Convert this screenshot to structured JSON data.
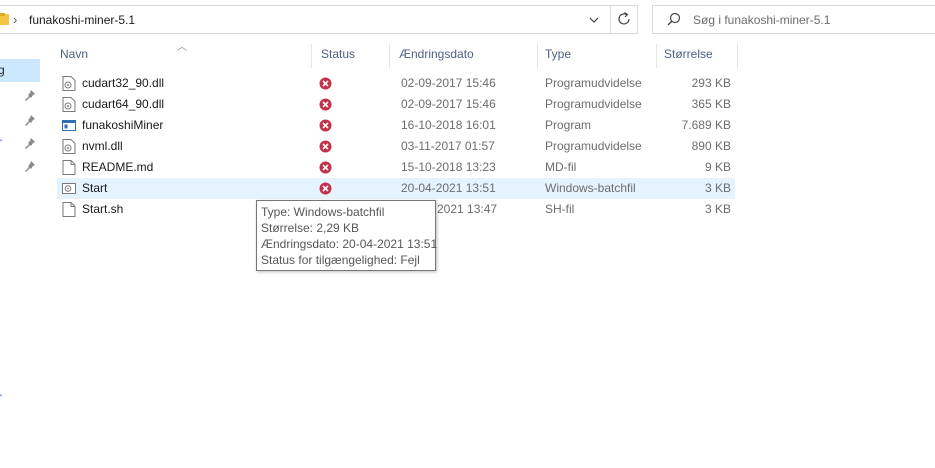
{
  "address": {
    "path": "funakoshi-miner-5.1",
    "separator": "›"
  },
  "search": {
    "placeholder": "Søg i funakoshi-miner-5.1"
  },
  "nav": {
    "selected_fragment": "g",
    "edge_fragments": [
      "r",
      "r"
    ]
  },
  "columns": {
    "name": "Navn",
    "status": "Status",
    "date": "Ændringsdato",
    "type": "Type",
    "size": "Størrelse"
  },
  "files": [
    {
      "name": "cudart32_90.dll",
      "date": "02-09-2017 15:46",
      "type": "Programudvidelse",
      "size": "293 KB",
      "icon": "dll-file-icon"
    },
    {
      "name": "cudart64_90.dll",
      "date": "02-09-2017 15:46",
      "type": "Programudvidelse",
      "size": "365 KB",
      "icon": "dll-file-icon"
    },
    {
      "name": "funakoshiMiner",
      "date": "16-10-2018 16:01",
      "type": "Program",
      "size": "7.689 KB",
      "icon": "exe-file-icon"
    },
    {
      "name": "nvml.dll",
      "date": "03-11-2017 01:57",
      "type": "Programudvidelse",
      "size": "890 KB",
      "icon": "dll-file-icon"
    },
    {
      "name": "README.md",
      "date": "15-10-2018 13:23",
      "type": "MD-fil",
      "size": "9 KB",
      "icon": "text-file-icon"
    },
    {
      "name": "Start",
      "date": "20-04-2021 13:51",
      "type": "Windows-batchfil",
      "size": "3 KB",
      "icon": "batch-file-icon"
    },
    {
      "name": "Start.sh",
      "date": "2021 13:47",
      "type": "SH-fil",
      "size": "3 KB",
      "icon": "text-file-icon"
    }
  ],
  "tooltip": {
    "type": "Type: Windows-batchfil",
    "size": "Størrelse: 2,29 KB",
    "date": "Ændringsdato: 20-04-2021 13:51",
    "status": "Status for tilgængelighed: Fejl"
  },
  "colors": {
    "error": "#c4314b",
    "selection": "#cce8ff",
    "hover": "#e5f3ff",
    "header_text": "#4d6082"
  }
}
